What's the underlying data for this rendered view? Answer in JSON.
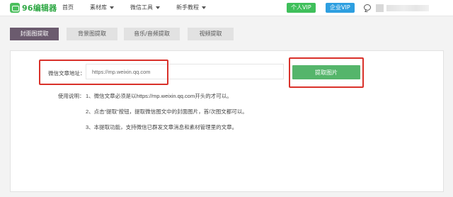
{
  "header": {
    "logo_text": "96编辑器",
    "nav": [
      {
        "label": "首页",
        "dropdown": false
      },
      {
        "label": "素材库",
        "dropdown": true
      },
      {
        "label": "微信工具",
        "dropdown": true
      },
      {
        "label": "新手教程",
        "dropdown": true
      }
    ],
    "vip_personal": "个人VIP",
    "vip_business": "企业VIP"
  },
  "tabs": [
    {
      "label": "封面图提取",
      "active": true
    },
    {
      "label": "背景图提取",
      "active": false
    },
    {
      "label": "音乐/音频提取",
      "active": false
    },
    {
      "label": "视频提取",
      "active": false
    }
  ],
  "form": {
    "url_label": "微信文章地址：",
    "url_placeholder": "https://mp.weixin.qq.com",
    "extract_button": "提取图片"
  },
  "help": {
    "label": "使用说明：",
    "lines": [
      "1、微信文章必须是以https://mp.weixin.qq.com开头的才可以。",
      "2、点击“提取”按钮，提取微信图文中的封面图片，首/次图文都可以。",
      "3、本提取功能，支持微信已群发文章消息和素材管理里的文章。"
    ]
  },
  "colors": {
    "active_tab": "#6b5b6e",
    "vip_personal": "#3fbf5b",
    "vip_business": "#2e9fe0",
    "extract_button": "#55b56b",
    "highlight_box": "#d9312a"
  }
}
